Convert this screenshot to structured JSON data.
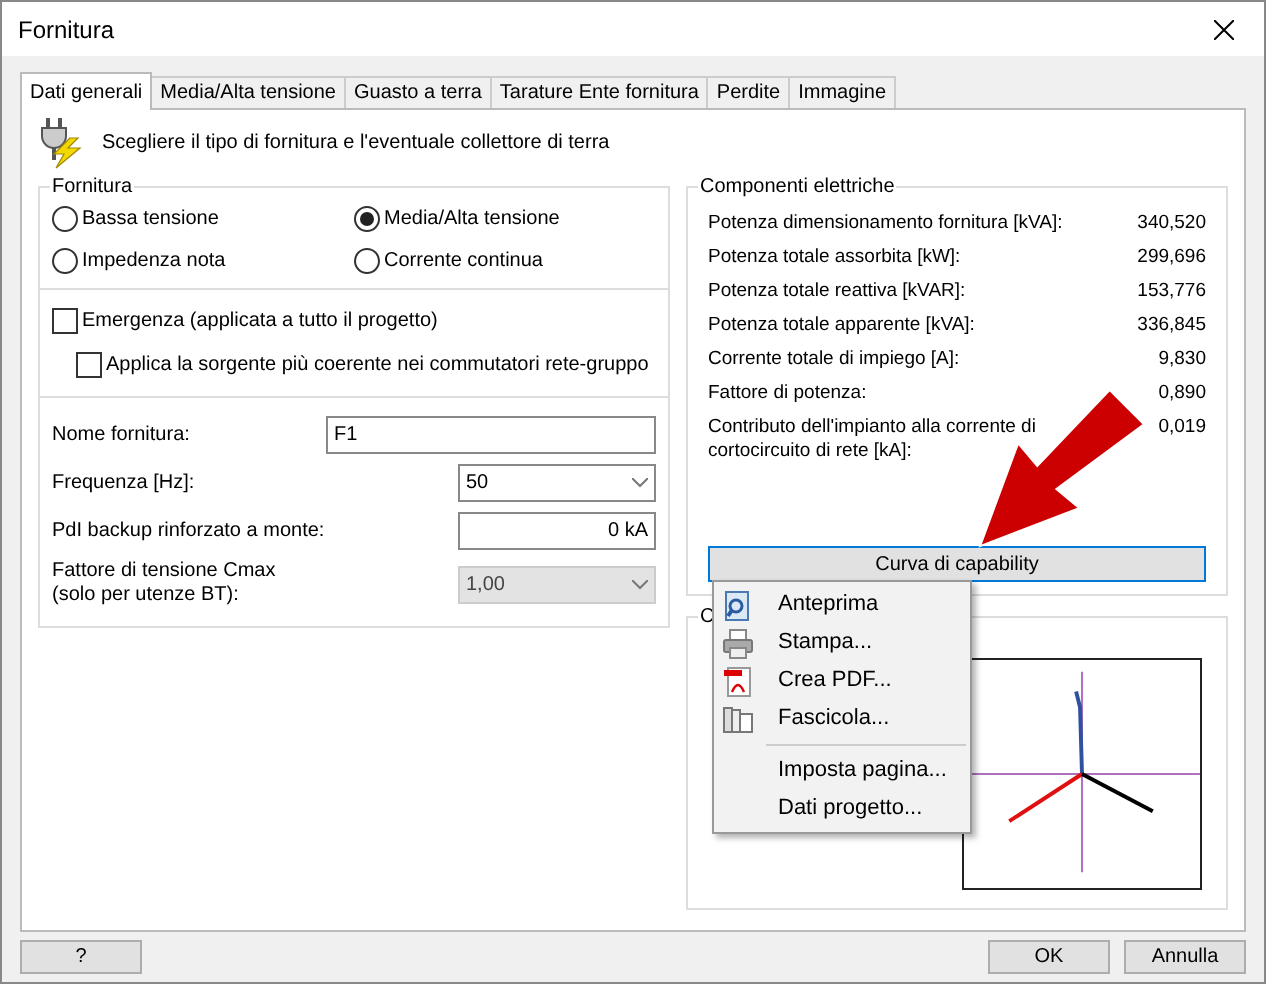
{
  "window": {
    "title": "Fornitura"
  },
  "tabs": [
    {
      "label": "Dati generali",
      "selected": true
    },
    {
      "label": "Media/Alta tensione",
      "selected": false
    },
    {
      "label": "Guasto a terra",
      "selected": false
    },
    {
      "label": "Tarature Ente fornitura",
      "selected": false
    },
    {
      "label": "Perdite",
      "selected": false
    },
    {
      "label": "Immagine",
      "selected": false
    }
  ],
  "intro": "Scegliere il tipo di fornitura e l'eventuale collettore di terra",
  "supply_group": {
    "title": "Fornitura",
    "options": [
      {
        "label": "Bassa tensione",
        "selected": false
      },
      {
        "label": "Media/Alta tensione",
        "selected": true
      },
      {
        "label": "Impedenza nota",
        "selected": false
      },
      {
        "label": "Corrente continua",
        "selected": false
      }
    ]
  },
  "checkboxes": [
    {
      "label": "Emergenza (applicata a tutto il progetto)",
      "checked": false
    },
    {
      "label": "Applica la sorgente più coerente nei commutatori rete-gruppo",
      "checked": false
    }
  ],
  "fields": [
    {
      "kind": "text",
      "label": "Nome fornitura:",
      "value": "F1"
    },
    {
      "kind": "select",
      "label": "Frequenza [Hz]:",
      "value": "50",
      "disabled": false
    },
    {
      "kind": "number",
      "label": "PdI backup rinforzato a monte:",
      "value": "0 kA"
    },
    {
      "kind": "select",
      "label": "Fattore di tensione Cmax\n(solo per utenze BT):",
      "value": "1,00",
      "disabled": true
    }
  ],
  "components": {
    "title": "Componenti elettriche",
    "rows": [
      {
        "label": "Potenza dimensionamento fornitura [kVA]:",
        "value": "340,520"
      },
      {
        "label": "Potenza totale assorbita [kW]:",
        "value": "299,696"
      },
      {
        "label": "Potenza totale reattiva [kVAR]:",
        "value": "153,776"
      },
      {
        "label": "Potenza totale apparente [kVA]:",
        "value": "336,845"
      },
      {
        "label": "Corrente totale di impiego [A]:",
        "value": "9,830"
      },
      {
        "label": "Fattore di potenza:",
        "value": "0,890"
      },
      {
        "label": "Contributo dell'impianto alla corrente di cortocircuito di rete [kA]:",
        "value": "0,019"
      }
    ],
    "button": "Curva di capability"
  },
  "lower_group": {
    "title": "C"
  },
  "menu": [
    {
      "kind": "preview",
      "label": "Anteprima"
    },
    {
      "kind": "print",
      "label": "Stampa..."
    },
    {
      "kind": "pdf",
      "label": "Crea PDF..."
    },
    {
      "kind": "binder",
      "label": "Fascicola..."
    },
    {
      "kind": "separator"
    },
    {
      "kind": "plain",
      "label": "Imposta pagina..."
    },
    {
      "kind": "plain",
      "label": "Dati progetto..."
    }
  ],
  "footer": {
    "help": "?",
    "ok": "OK",
    "cancel": "Annulla"
  }
}
